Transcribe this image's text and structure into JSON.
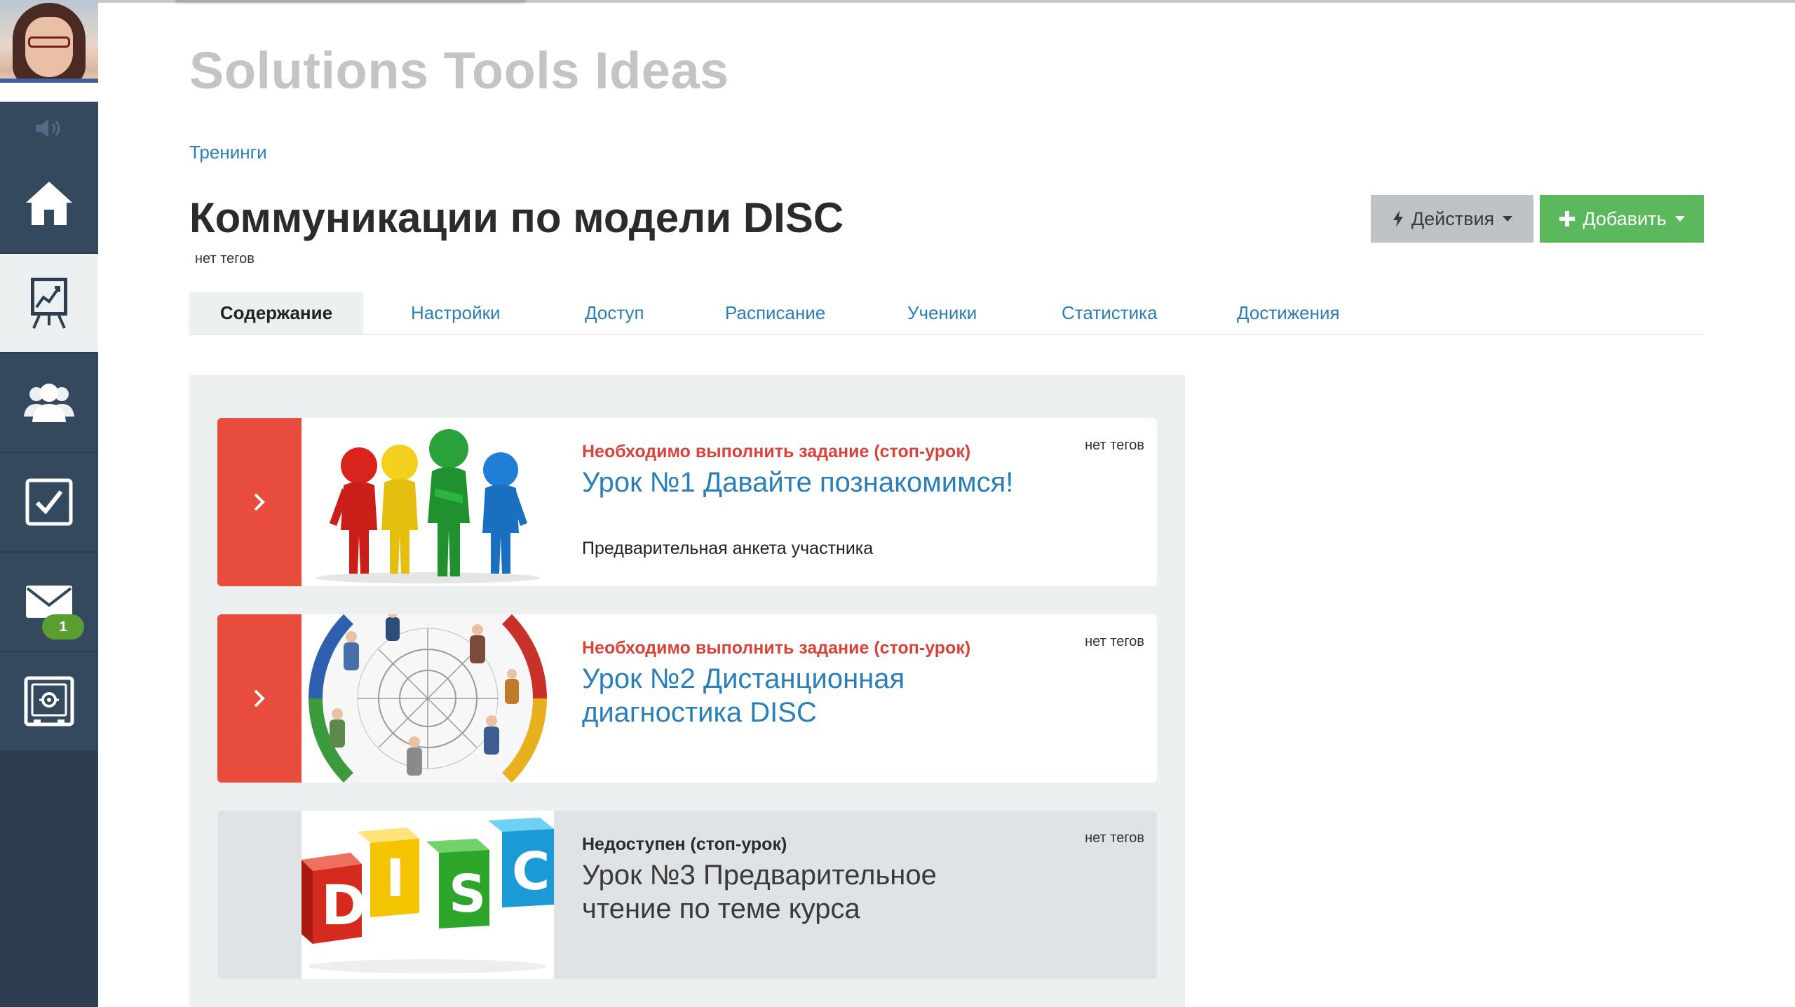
{
  "site": {
    "title": "Solutions Tools Ideas"
  },
  "breadcrumb": {
    "label": "Тренинги"
  },
  "page": {
    "title": "Коммуникации по модели DISC",
    "tags": "нет тегов"
  },
  "buttons": {
    "actions_label": "Действия",
    "add_label": "Добавить"
  },
  "tabs": [
    {
      "label": "Содержание",
      "active": true
    },
    {
      "label": "Настройки"
    },
    {
      "label": "Доступ"
    },
    {
      "label": "Расписание"
    },
    {
      "label": "Ученики"
    },
    {
      "label": "Статистика"
    },
    {
      "label": "Достижения"
    }
  ],
  "sidebar": {
    "items": [
      {
        "icon": "home-icon"
      },
      {
        "icon": "trainings-chart-icon",
        "active": true
      },
      {
        "icon": "users-icon"
      },
      {
        "icon": "tasks-checkbox-icon"
      },
      {
        "icon": "mail-icon",
        "badge": "1"
      },
      {
        "icon": "safe-icon"
      }
    ]
  },
  "lessons": [
    {
      "status": "Необходимо выполнить задание (стоп-урок)",
      "title": "Урок №1 Давайте познакомимся!",
      "description": "Предварительная анкета участника",
      "tags": "нет тегов"
    },
    {
      "status": "Необходимо выполнить задание (стоп-урок)",
      "title": "Урок №2 Дистанционная диагностика DISC",
      "description": "",
      "tags": "нет тегов"
    },
    {
      "status": "Недоступен (стоп-урок)",
      "title": "Урок №3 Предварительное чтение по теме курса",
      "description": "",
      "tags": "нет тегов",
      "thumb_text": [
        "D",
        "I",
        "S",
        "C"
      ]
    }
  ],
  "colors": {
    "sidebar": "#2c3e50",
    "accent_red": "#e74c3c",
    "link_blue": "#2a7fb8",
    "add_green": "#5cb85c"
  }
}
